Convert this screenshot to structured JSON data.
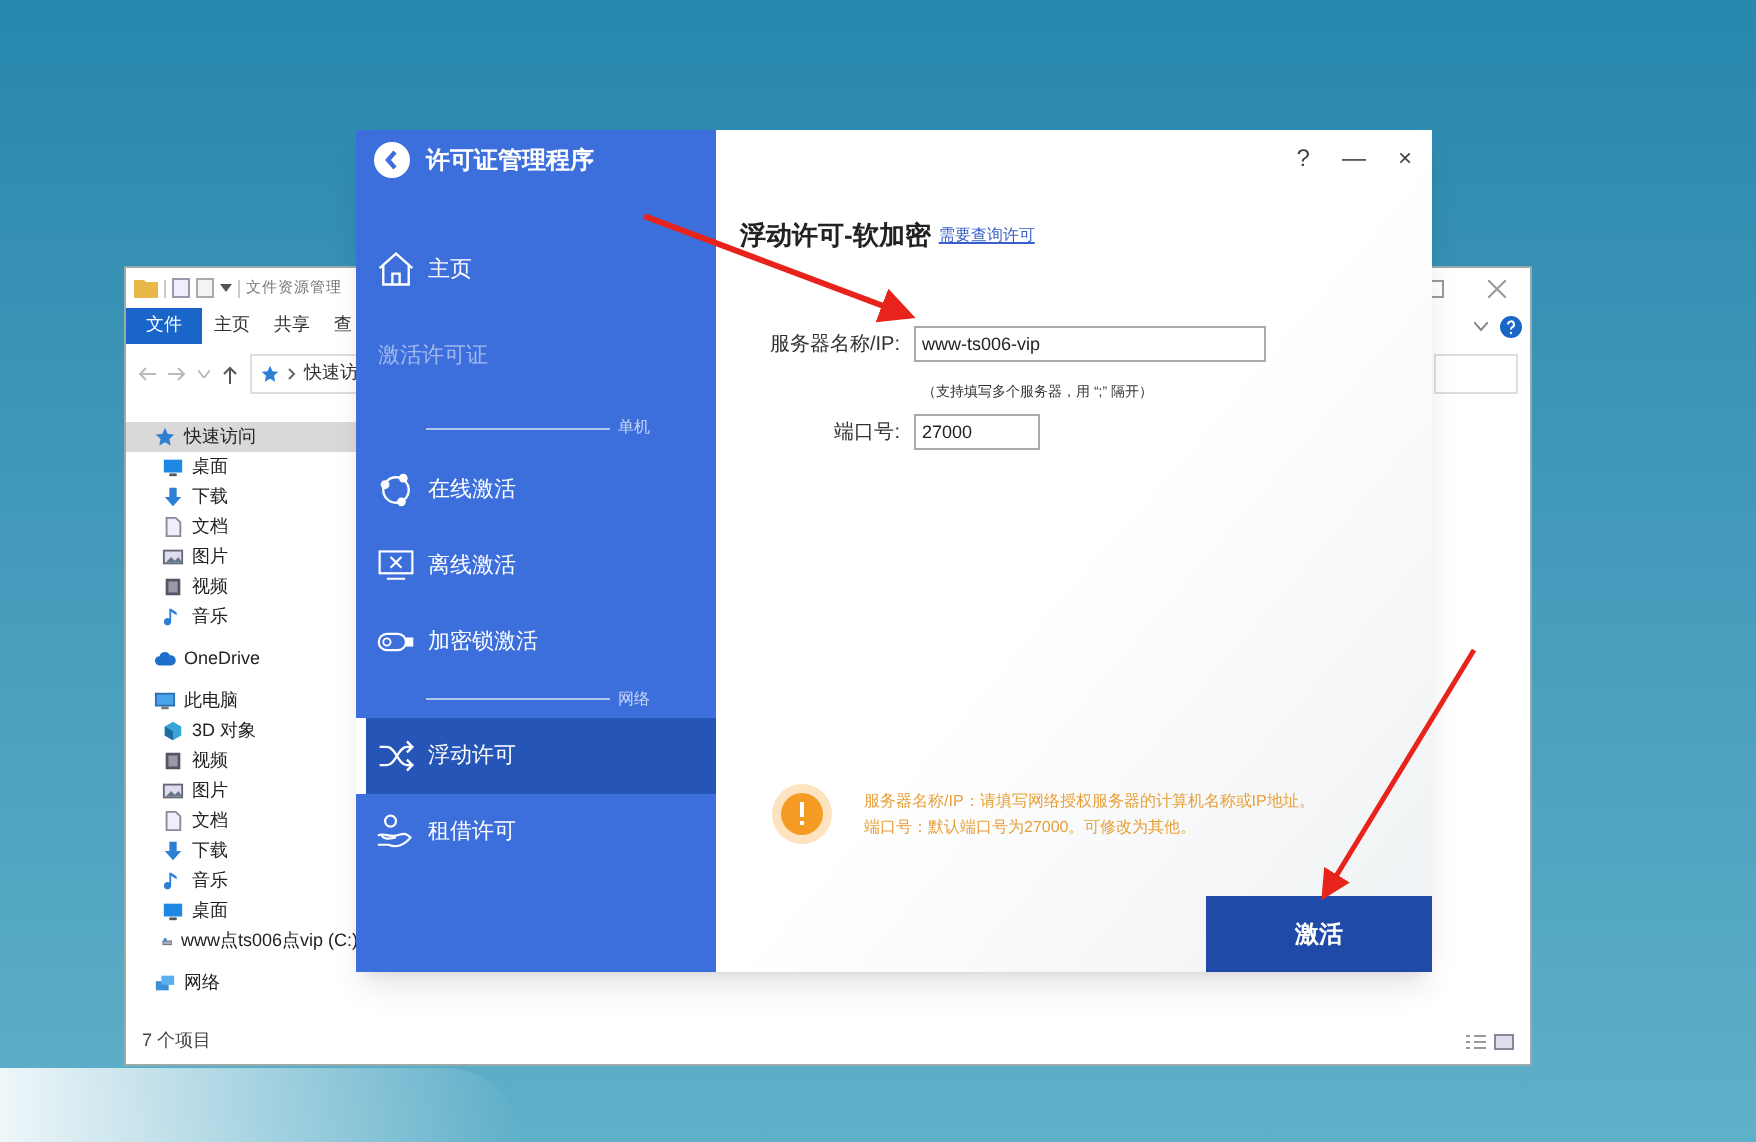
{
  "explorer": {
    "title": "文件资源管理",
    "ribbon_tabs": [
      {
        "label": "文件",
        "selected": true
      },
      {
        "label": "主页",
        "selected": false
      },
      {
        "label": "共享",
        "selected": false
      },
      {
        "label": "查",
        "selected": false
      }
    ],
    "address": "快速访",
    "tree": [
      {
        "label": "快速访问",
        "kind": "star",
        "selected": true,
        "children": [
          {
            "label": "桌面",
            "kind": "desktop",
            "selected": false
          },
          {
            "label": "下载",
            "kind": "download",
            "selected": false
          },
          {
            "label": "文档",
            "kind": "document",
            "selected": false
          },
          {
            "label": "图片",
            "kind": "picture",
            "selected": false
          },
          {
            "label": "视频",
            "kind": "video",
            "selected": false
          },
          {
            "label": "音乐",
            "kind": "music",
            "selected": false
          }
        ]
      },
      {
        "label": "OneDrive",
        "kind": "cloud",
        "selected": false
      },
      {
        "label": "此电脑",
        "kind": "pc",
        "selected": false,
        "children": [
          {
            "label": "3D 对象",
            "kind": "cube",
            "selected": false
          },
          {
            "label": "视频",
            "kind": "video",
            "selected": false
          },
          {
            "label": "图片",
            "kind": "picture",
            "selected": false
          },
          {
            "label": "文档",
            "kind": "document",
            "selected": false
          },
          {
            "label": "下载",
            "kind": "download",
            "selected": false
          },
          {
            "label": "音乐",
            "kind": "music",
            "selected": false
          },
          {
            "label": "桌面",
            "kind": "desktop",
            "selected": false
          },
          {
            "label": "www点ts006点vip (C:)",
            "kind": "drive",
            "selected": false
          }
        ]
      },
      {
        "label": "网络",
        "kind": "network",
        "selected": false
      }
    ],
    "status_bar": "7 个项目"
  },
  "dialog": {
    "title": "许可证管理程序",
    "sidebar": {
      "items": [
        {
          "kind": "home",
          "label": "主页",
          "selected": false
        },
        {
          "kind": "section",
          "label": "激活许可证"
        },
        {
          "kind": "divider",
          "label": "单机"
        },
        {
          "kind": "online",
          "label": "在线激活",
          "selected": false
        },
        {
          "kind": "offline",
          "label": "离线激活",
          "selected": false
        },
        {
          "kind": "dongle",
          "label": "加密锁激活",
          "selected": false
        },
        {
          "kind": "divider",
          "label": "网络"
        },
        {
          "kind": "floating",
          "label": "浮动许可",
          "selected": true
        },
        {
          "kind": "borrow",
          "label": "租借许可",
          "selected": false
        }
      ]
    },
    "controls": [
      "?",
      "—",
      "×"
    ],
    "heading": "浮动许可-软加密",
    "link": "需要查询许可",
    "fields": [
      {
        "label": "服务器名称/IP:",
        "value": "www-ts006-vip",
        "hint": "（支持填写多个服务器，用 “;” 隔开）"
      },
      {
        "label": "端口号:",
        "value": "27000"
      }
    ],
    "notice": [
      "服务器名称/IP：请填写网络授权服务器的计算机名称或IP地址。",
      "端口号：默认端口号为27000。可修改为其他。"
    ],
    "button": "激活"
  }
}
